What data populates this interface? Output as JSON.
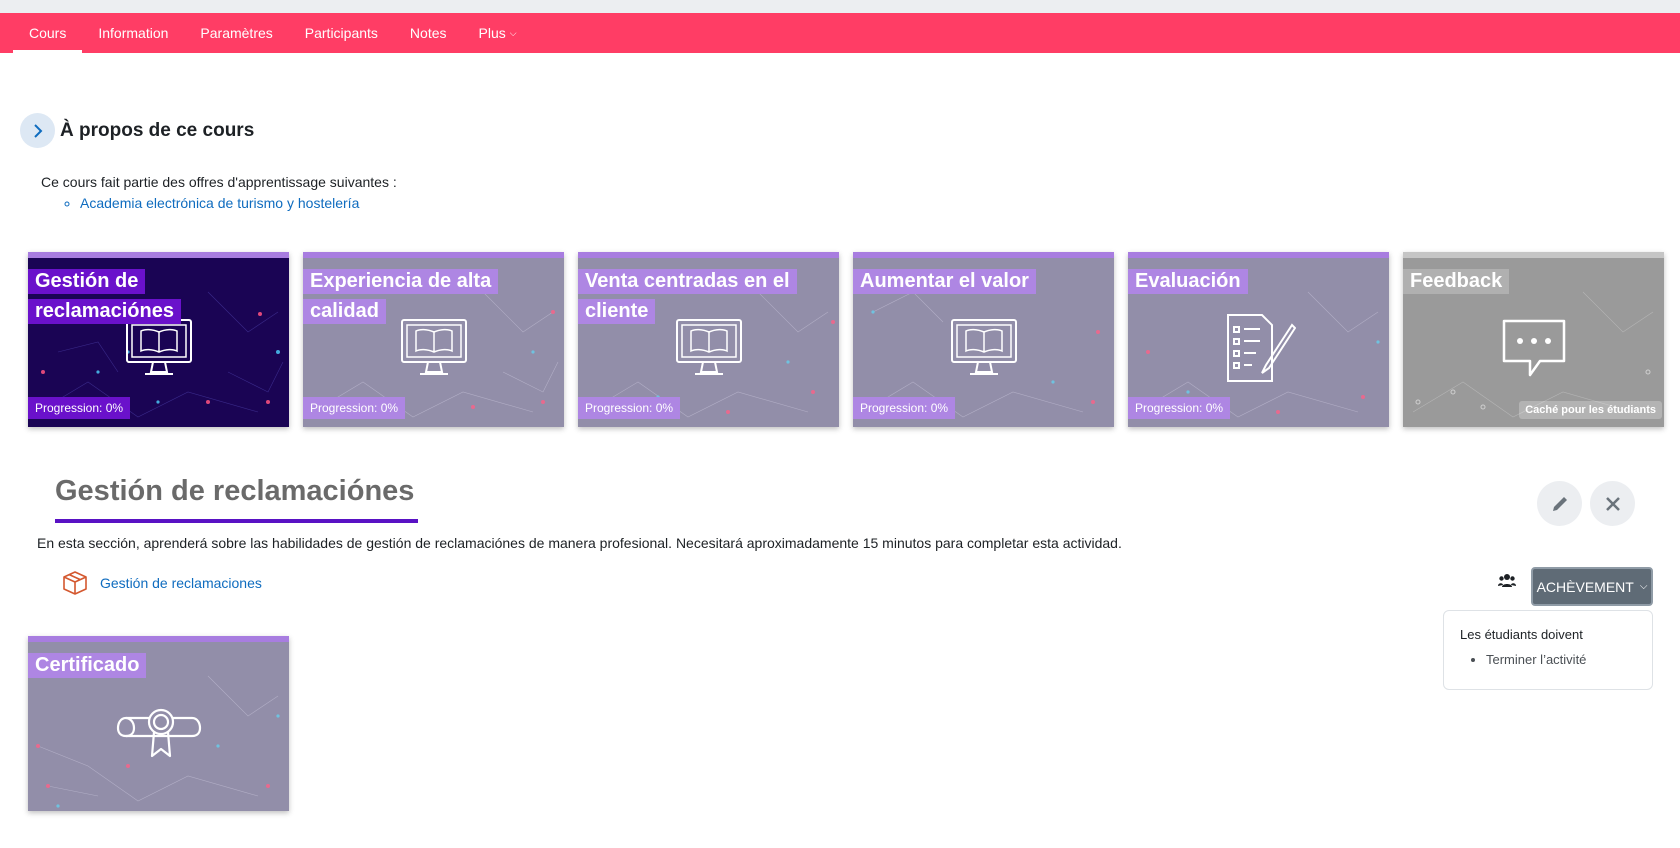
{
  "nav": {
    "items": [
      {
        "label": "Cours",
        "active": true
      },
      {
        "label": "Information",
        "active": false
      },
      {
        "label": "Paramètres",
        "active": false
      },
      {
        "label": "Participants",
        "active": false
      },
      {
        "label": "Notes",
        "active": false
      },
      {
        "label": "Plus",
        "active": false,
        "has_dropdown": true
      }
    ]
  },
  "about": {
    "title": "À propos de ce cours",
    "text": "Ce cours fait partie des offres d'apprentissage suivantes :",
    "offers": [
      "Academia electrónica de turismo y hostelería"
    ]
  },
  "tiles": [
    {
      "title": "Gestión de reclamaciónes",
      "progress": "Progression: 0%",
      "icon": "monitor-book-icon",
      "active": true
    },
    {
      "title": "Experiencia de alta calidad",
      "progress": "Progression: 0%",
      "icon": "monitor-book-icon"
    },
    {
      "title": "Venta centradas en el cliente",
      "progress": "Progression: 0%",
      "icon": "monitor-book-icon"
    },
    {
      "title": "Aumentar el valor",
      "progress": "Progression: 0%",
      "icon": "monitor-book-icon"
    },
    {
      "title": "Evaluación",
      "progress": "Progression: 0%",
      "icon": "checklist-icon"
    },
    {
      "title": "Feedback",
      "hidden_label": "Caché pour les étudiants",
      "icon": "speech-bubble-icon",
      "hidden": true
    }
  ],
  "section": {
    "title": "Gestión de reclamaciónes",
    "description": "En esta sección, aprenderá sobre las habilidades de gestión de reclamaciónes de manera profesional. Necesitará aproximadamente 15 minutos para completar esta actividad.",
    "activity_link": "Gestión de reclamaciones",
    "achievement_button": "ACHÈVEMENT",
    "popover_heading": "Les étudiants doivent",
    "popover_items": [
      "Terminer l’activité"
    ]
  },
  "certificate_tile": {
    "title": "Certificado",
    "icon": "certificate-icon"
  },
  "colors": {
    "navbar": "#ff3d65",
    "active_tile": "#1a0454",
    "inactive_tile": "#928ea9",
    "hidden_tile": "#9a9a9a",
    "title_highlight_active": "#6a11cb",
    "title_highlight": "#ae86e3",
    "accent": "#5912c4",
    "link": "#0f6cbf"
  }
}
